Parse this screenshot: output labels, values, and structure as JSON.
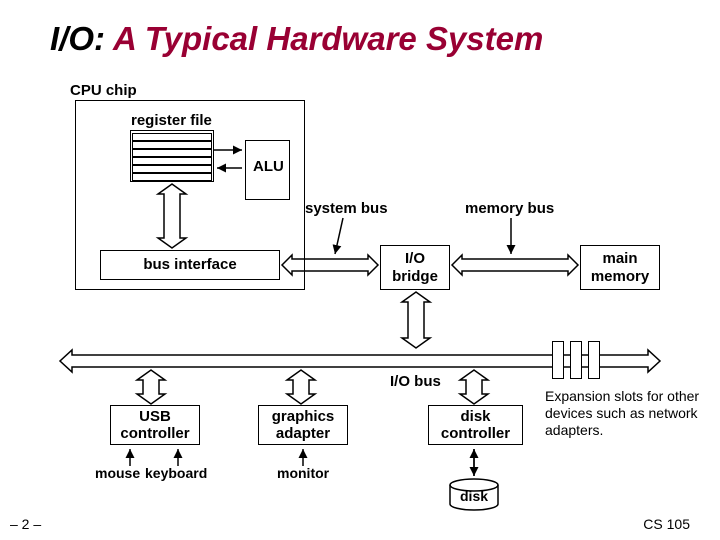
{
  "title_prefix": "I/O:",
  "title_rest": " A Typical Hardware System",
  "labels": {
    "cpu_chip": "CPU chip",
    "register_file": "register file",
    "alu": "ALU",
    "system_bus": "system bus",
    "memory_bus": "memory bus",
    "bus_interface": "bus interface",
    "io_bridge": "I/O\nbridge",
    "main_memory": "main\nmemory",
    "io_bus": "I/O bus",
    "usb_controller": "USB\ncontroller",
    "graphics_adapter": "graphics\nadapter",
    "disk_controller": "disk\ncontroller",
    "mouse": "mouse",
    "keyboard": "keyboard",
    "monitor": "monitor",
    "disk": "disk",
    "expansion": "Expansion slots for other devices such as network adapters."
  },
  "footer": {
    "page": "– 2 –",
    "course": "CS 105"
  }
}
